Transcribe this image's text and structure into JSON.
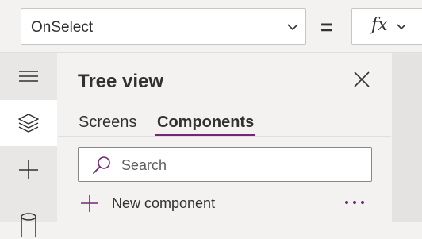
{
  "formula_bar": {
    "property_value": "OnSelect",
    "equals_sign": "=",
    "fx_label": "fx"
  },
  "left_rail": {
    "items": [
      {
        "icon": "hamburger-menu-icon",
        "active": false
      },
      {
        "icon": "layers-icon",
        "active": true
      },
      {
        "icon": "plus-icon",
        "active": false
      },
      {
        "icon": "database-icon",
        "active": false
      }
    ]
  },
  "tree_view": {
    "title": "Tree view",
    "tabs": [
      {
        "label": "Screens",
        "active": false
      },
      {
        "label": "Components",
        "active": true
      }
    ],
    "search_placeholder": "Search",
    "new_component_label": "New component"
  },
  "colors": {
    "accent": "#742774",
    "background": "#f3f2f1",
    "rail": "#e9e7e5",
    "text": "#323130"
  }
}
